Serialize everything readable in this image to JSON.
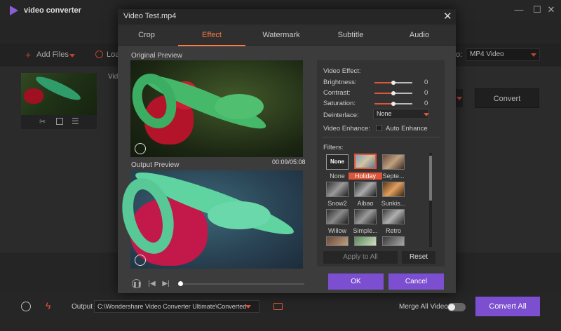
{
  "app": {
    "title": "video converter",
    "minimize": "—",
    "maximize": "☐",
    "close": "✕"
  },
  "toolbar": {
    "add_files": "Add Files",
    "load": "Loa",
    "output_label": "o:",
    "output_format": "MP4 Video"
  },
  "main": {
    "video_label": "Video",
    "convert": "Convert"
  },
  "dialog": {
    "title": "Video Test.mp4",
    "close": "✕",
    "tabs": [
      "Crop",
      "Effect",
      "Watermark",
      "Subtitle",
      "Audio"
    ],
    "active_tab": "Effect",
    "original_preview": "Original Preview",
    "output_preview": "Output Preview",
    "time": "00:09/05:08",
    "effect_panel": {
      "heading": "Video Effect:",
      "brightness_label": "Brightness:",
      "brightness_value": "0",
      "contrast_label": "Contrast:",
      "contrast_value": "0",
      "saturation_label": "Saturation:",
      "saturation_value": "0",
      "deinterlace_label": "Deinterlace:",
      "deinterlace_value": "None",
      "enhance_label": "Video Enhance:",
      "auto_enhance": "Auto Enhance",
      "filters_label": "Filters:",
      "filters": [
        {
          "name": "None",
          "selected": false,
          "thumb": "None"
        },
        {
          "name": "Holiday",
          "selected": true
        },
        {
          "name": "Septe..."
        },
        {
          "name": "Snow2"
        },
        {
          "name": "Aibao"
        },
        {
          "name": "Sunkis..."
        },
        {
          "name": "Willow"
        },
        {
          "name": "Simple..."
        },
        {
          "name": "Retro"
        }
      ],
      "apply_all": "Apply to All",
      "reset": "Reset"
    },
    "ok": "OK",
    "cancel": "Cancel"
  },
  "bottom": {
    "output_label": "Output",
    "output_path": "C:\\Wondershare Video Converter Ultimate\\Converted",
    "merge_label": "Merge All Videos",
    "convert_all": "Convert All"
  },
  "colors": {
    "accent": "#ff7a45",
    "purple": "#7c4fd0",
    "red": "#e0553a"
  }
}
